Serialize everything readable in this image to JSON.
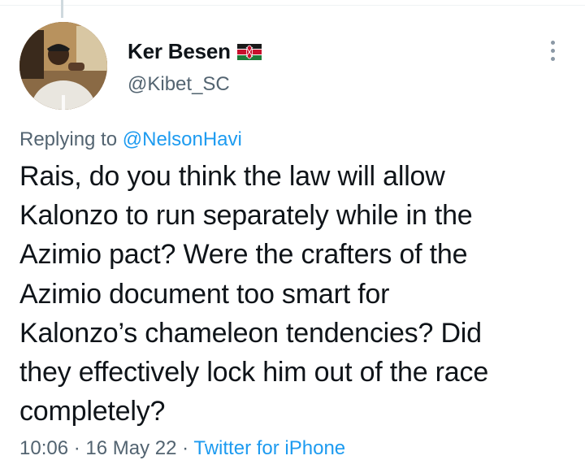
{
  "tweet": {
    "author": {
      "display_name": "Ker Besen",
      "handle": "@Kibet_SC",
      "flag_icon": "kenya-flag-icon",
      "avatar_icon": "profile-photo"
    },
    "more_icon": "more-vertical-icon",
    "replying_prefix": "Replying to",
    "replying_to": "@NelsonHavi",
    "text_lines": [
      "Rais, do you think the law will allow",
      "Kalonzo to run separately while in the",
      "Azimio pact? Were the crafters of the",
      "Azimio document too smart for",
      "Kalonzo’s chameleon tendencies? Did",
      "they effectively lock him out of the race",
      "completely?"
    ],
    "time": "10:06",
    "date": "16 May 22",
    "separator": "·",
    "source": "Twitter for iPhone"
  },
  "colors": {
    "text_primary": "#0f1419",
    "text_secondary": "#536471",
    "link_blue": "#1d9bf0",
    "thread_line": "#cfd9de"
  }
}
